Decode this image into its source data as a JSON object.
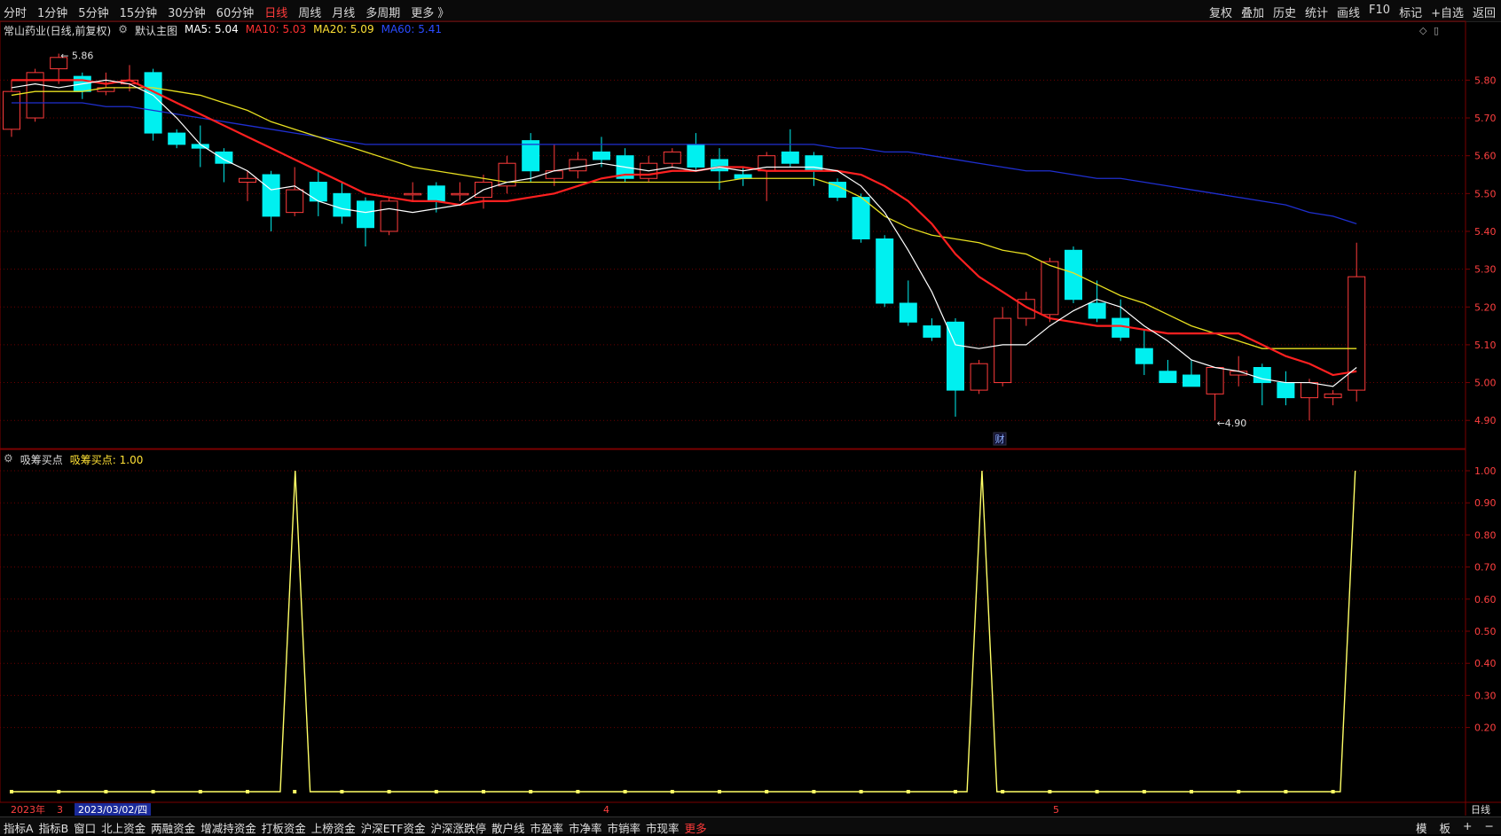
{
  "toolbar": {
    "periods": [
      "分时",
      "1分钟",
      "5分钟",
      "15分钟",
      "30分钟",
      "60分钟",
      "日线",
      "周线",
      "月线",
      "多周期",
      "更多 》"
    ],
    "active_period": "日线",
    "tools": [
      "复权",
      "叠加",
      "历史",
      "统计",
      "画线",
      "F10",
      "标记",
      "+自选",
      "返回"
    ]
  },
  "main": {
    "stock_title": "常山药业(日线,前复权)",
    "main_chart_label": "默认主图",
    "ma5": "MA5: 5.04",
    "ma10": "MA10: 5.03",
    "ma20": "MA20: 5.09",
    "ma60": "MA60: 5.41",
    "high_marker": "5.86",
    "low_marker": "4.90",
    "fin_badge": "财",
    "y_ticks": [
      "5.80",
      "5.70",
      "5.60",
      "5.50",
      "5.40",
      "5.30",
      "5.20",
      "5.10",
      "5.00",
      "4.90"
    ]
  },
  "sub": {
    "name": "吸筹买点",
    "value": "吸筹买点: 1.00",
    "y_ticks": [
      "1.00",
      "0.90",
      "0.80",
      "0.70",
      "0.60",
      "0.50",
      "0.40",
      "0.30",
      "0.20"
    ]
  },
  "timeaxis": {
    "year": "2023年",
    "m3": "3",
    "date": "2023/03/02/四",
    "m4": "4",
    "m5": "5",
    "period_label": "日线"
  },
  "bottom": {
    "items": [
      "指标A",
      "指标B",
      "窗口",
      "北上资金",
      "两融资金",
      "增减持资金",
      "打板资金",
      "上榜资金",
      "沪深ETF资金",
      "沪深涨跌停",
      "散户线",
      "市盈率",
      "市净率",
      "市销率",
      "市现率",
      "更多"
    ],
    "right": [
      "模",
      "板",
      "+",
      "−"
    ]
  },
  "colors": {
    "up": "#ff3b3b",
    "down": "#00f0f0",
    "ma5": "#ffffff",
    "ma10": "#ff2020",
    "ma20": "#e8e020",
    "ma60": "#1f2fd0",
    "signal": "#ffff66",
    "grid": "#6b0000"
  },
  "chart_data": [
    {
      "type": "candlestick",
      "title": "常山药业(日线,前复权)",
      "ylim": [
        4.87,
        5.89
      ],
      "candles": [
        {
          "o": 5.67,
          "h": 5.8,
          "l": 5.65,
          "c": 5.77
        },
        {
          "o": 5.7,
          "h": 5.83,
          "l": 5.69,
          "c": 5.82
        },
        {
          "o": 5.83,
          "h": 5.87,
          "l": 5.79,
          "c": 5.86
        },
        {
          "o": 5.81,
          "h": 5.82,
          "l": 5.75,
          "c": 5.77
        },
        {
          "o": 5.77,
          "h": 5.82,
          "l": 5.76,
          "c": 5.78
        },
        {
          "o": 5.79,
          "h": 5.84,
          "l": 5.77,
          "c": 5.8
        },
        {
          "o": 5.82,
          "h": 5.83,
          "l": 5.64,
          "c": 5.66
        },
        {
          "o": 5.66,
          "h": 5.67,
          "l": 5.62,
          "c": 5.63
        },
        {
          "o": 5.63,
          "h": 5.68,
          "l": 5.57,
          "c": 5.62
        },
        {
          "o": 5.61,
          "h": 5.62,
          "l": 5.53,
          "c": 5.58
        },
        {
          "o": 5.53,
          "h": 5.56,
          "l": 5.48,
          "c": 5.54
        },
        {
          "o": 5.55,
          "h": 5.56,
          "l": 5.4,
          "c": 5.44
        },
        {
          "o": 5.45,
          "h": 5.57,
          "l": 5.44,
          "c": 5.51
        },
        {
          "o": 5.53,
          "h": 5.56,
          "l": 5.44,
          "c": 5.48
        },
        {
          "o": 5.5,
          "h": 5.53,
          "l": 5.42,
          "c": 5.44
        },
        {
          "o": 5.48,
          "h": 5.49,
          "l": 5.36,
          "c": 5.41
        },
        {
          "o": 5.4,
          "h": 5.49,
          "l": 5.39,
          "c": 5.48
        },
        {
          "o": 5.5,
          "h": 5.53,
          "l": 5.48,
          "c": 5.5
        },
        {
          "o": 5.52,
          "h": 5.53,
          "l": 5.45,
          "c": 5.48
        },
        {
          "o": 5.5,
          "h": 5.53,
          "l": 5.48,
          "c": 5.5
        },
        {
          "o": 5.49,
          "h": 5.55,
          "l": 5.46,
          "c": 5.53
        },
        {
          "o": 5.52,
          "h": 5.6,
          "l": 5.5,
          "c": 5.58
        },
        {
          "o": 5.64,
          "h": 5.66,
          "l": 5.53,
          "c": 5.56
        },
        {
          "o": 5.54,
          "h": 5.63,
          "l": 5.52,
          "c": 5.56
        },
        {
          "o": 5.56,
          "h": 5.61,
          "l": 5.54,
          "c": 5.59
        },
        {
          "o": 5.61,
          "h": 5.65,
          "l": 5.57,
          "c": 5.59
        },
        {
          "o": 5.6,
          "h": 5.62,
          "l": 5.53,
          "c": 5.54
        },
        {
          "o": 5.54,
          "h": 5.6,
          "l": 5.53,
          "c": 5.58
        },
        {
          "o": 5.58,
          "h": 5.62,
          "l": 5.57,
          "c": 5.61
        },
        {
          "o": 5.63,
          "h": 5.66,
          "l": 5.56,
          "c": 5.57
        },
        {
          "o": 5.59,
          "h": 5.62,
          "l": 5.51,
          "c": 5.56
        },
        {
          "o": 5.55,
          "h": 5.57,
          "l": 5.52,
          "c": 5.54
        },
        {
          "o": 5.56,
          "h": 5.61,
          "l": 5.48,
          "c": 5.6
        },
        {
          "o": 5.61,
          "h": 5.67,
          "l": 5.57,
          "c": 5.58
        },
        {
          "o": 5.6,
          "h": 5.61,
          "l": 5.52,
          "c": 5.56
        },
        {
          "o": 5.53,
          "h": 5.54,
          "l": 5.48,
          "c": 5.49
        },
        {
          "o": 5.49,
          "h": 5.5,
          "l": 5.37,
          "c": 5.38
        },
        {
          "o": 5.38,
          "h": 5.39,
          "l": 5.2,
          "c": 5.21
        },
        {
          "o": 5.21,
          "h": 5.27,
          "l": 5.15,
          "c": 5.16
        },
        {
          "o": 5.15,
          "h": 5.17,
          "l": 5.11,
          "c": 5.12
        },
        {
          "o": 5.16,
          "h": 5.17,
          "l": 4.91,
          "c": 4.98
        },
        {
          "o": 4.98,
          "h": 5.06,
          "l": 4.97,
          "c": 5.05
        },
        {
          "o": 5.0,
          "h": 5.2,
          "l": 4.99,
          "c": 5.17
        },
        {
          "o": 5.17,
          "h": 5.24,
          "l": 5.15,
          "c": 5.22
        },
        {
          "o": 5.18,
          "h": 5.33,
          "l": 5.16,
          "c": 5.32
        },
        {
          "o": 5.35,
          "h": 5.36,
          "l": 5.21,
          "c": 5.22
        },
        {
          "o": 5.21,
          "h": 5.27,
          "l": 5.16,
          "c": 5.17
        },
        {
          "o": 5.17,
          "h": 5.22,
          "l": 5.11,
          "c": 5.12
        },
        {
          "o": 5.09,
          "h": 5.14,
          "l": 5.02,
          "c": 5.05
        },
        {
          "o": 5.03,
          "h": 5.06,
          "l": 5.0,
          "c": 5.0
        },
        {
          "o": 5.02,
          "h": 5.06,
          "l": 4.99,
          "c": 4.99
        },
        {
          "o": 4.97,
          "h": 5.04,
          "l": 4.9,
          "c": 5.04
        },
        {
          "o": 5.02,
          "h": 5.07,
          "l": 4.99,
          "c": 5.03
        },
        {
          "o": 5.04,
          "h": 5.05,
          "l": 4.94,
          "c": 5.0
        },
        {
          "o": 5.0,
          "h": 5.03,
          "l": 4.94,
          "c": 4.96
        },
        {
          "o": 4.96,
          "h": 5.01,
          "l": 4.9,
          "c": 5.0
        },
        {
          "o": 4.96,
          "h": 4.98,
          "l": 4.94,
          "c": 4.97
        },
        {
          "o": 4.98,
          "h": 5.37,
          "l": 4.95,
          "c": 5.28
        }
      ],
      "ma5": [
        5.78,
        5.79,
        5.78,
        5.79,
        5.8,
        5.79,
        5.76,
        5.7,
        5.63,
        5.59,
        5.56,
        5.51,
        5.52,
        5.48,
        5.46,
        5.45,
        5.46,
        5.45,
        5.46,
        5.47,
        5.51,
        5.53,
        5.54,
        5.56,
        5.57,
        5.58,
        5.57,
        5.56,
        5.57,
        5.56,
        5.57,
        5.56,
        5.57,
        5.57,
        5.57,
        5.56,
        5.52,
        5.45,
        5.35,
        5.24,
        5.1,
        5.09,
        5.1,
        5.1,
        5.15,
        5.19,
        5.22,
        5.2,
        5.15,
        5.11,
        5.06,
        5.04,
        5.03,
        5.01,
        5.0,
        5.0,
        4.99,
        5.04
      ],
      "ma10": [
        5.8,
        5.8,
        5.8,
        5.8,
        5.79,
        5.8,
        5.77,
        5.74,
        5.71,
        5.68,
        5.65,
        5.62,
        5.59,
        5.56,
        5.53,
        5.5,
        5.49,
        5.48,
        5.48,
        5.47,
        5.48,
        5.48,
        5.49,
        5.5,
        5.52,
        5.54,
        5.55,
        5.55,
        5.56,
        5.56,
        5.57,
        5.57,
        5.56,
        5.56,
        5.56,
        5.56,
        5.55,
        5.52,
        5.48,
        5.42,
        5.34,
        5.28,
        5.24,
        5.2,
        5.17,
        5.16,
        5.15,
        5.15,
        5.14,
        5.13,
        5.13,
        5.13,
        5.13,
        5.1,
        5.07,
        5.05,
        5.02,
        5.03
      ],
      "ma20": [
        5.76,
        5.77,
        5.77,
        5.77,
        5.78,
        5.78,
        5.78,
        5.77,
        5.76,
        5.74,
        5.72,
        5.69,
        5.67,
        5.65,
        5.63,
        5.61,
        5.59,
        5.57,
        5.56,
        5.55,
        5.54,
        5.53,
        5.53,
        5.53,
        5.53,
        5.53,
        5.53,
        5.53,
        5.53,
        5.53,
        5.53,
        5.54,
        5.54,
        5.54,
        5.54,
        5.52,
        5.49,
        5.44,
        5.41,
        5.39,
        5.38,
        5.37,
        5.35,
        5.34,
        5.31,
        5.29,
        5.26,
        5.23,
        5.21,
        5.18,
        5.15,
        5.13,
        5.11,
        5.09,
        5.09,
        5.09,
        5.09,
        5.09
      ],
      "ma60": [
        5.74,
        5.74,
        5.74,
        5.74,
        5.73,
        5.73,
        5.72,
        5.71,
        5.7,
        5.69,
        5.68,
        5.67,
        5.66,
        5.65,
        5.64,
        5.63,
        5.63,
        5.63,
        5.63,
        5.63,
        5.63,
        5.63,
        5.63,
        5.63,
        5.63,
        5.63,
        5.63,
        5.63,
        5.63,
        5.63,
        5.63,
        5.63,
        5.63,
        5.63,
        5.63,
        5.62,
        5.62,
        5.61,
        5.61,
        5.6,
        5.59,
        5.58,
        5.57,
        5.56,
        5.56,
        5.55,
        5.54,
        5.54,
        5.53,
        5.52,
        5.51,
        5.5,
        5.49,
        5.48,
        5.47,
        5.45,
        5.44,
        5.42
      ]
    },
    {
      "type": "line",
      "title": "吸筹买点",
      "ylim": [
        0.0,
        1.0
      ],
      "series": [
        {
          "name": "吸筹买点",
          "values": [
            0,
            0,
            0,
            0,
            0,
            0,
            0,
            0,
            0,
            0,
            0,
            0,
            0,
            0,
            0,
            0,
            0,
            0,
            0,
            1,
            0,
            0,
            0,
            0,
            0,
            0,
            0,
            0,
            0,
            0,
            0,
            0,
            0,
            0,
            0,
            0,
            0,
            0,
            0,
            0,
            0,
            0,
            0,
            0,
            0,
            0,
            0,
            0,
            0,
            0,
            0,
            0,
            0,
            0,
            0,
            0,
            0,
            0,
            0,
            0,
            0,
            0,
            0,
            0,
            0,
            1,
            0,
            0,
            0,
            0,
            0,
            0,
            0,
            0,
            0,
            0,
            0,
            0,
            0,
            0,
            0,
            0,
            0,
            0,
            0,
            0,
            0,
            0,
            0,
            0,
            1
          ]
        }
      ]
    }
  ]
}
